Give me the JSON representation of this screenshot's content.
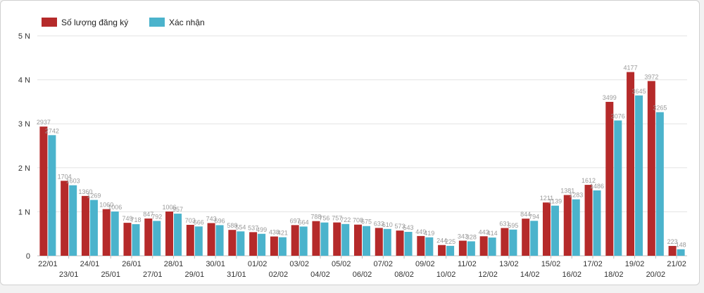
{
  "chart_data": {
    "type": "bar",
    "categories": [
      "22/01",
      "23/01",
      "24/01",
      "25/01",
      "26/01",
      "27/01",
      "28/01",
      "29/01",
      "30/01",
      "31/01",
      "01/02",
      "02/02",
      "03/02",
      "04/02",
      "05/02",
      "06/02",
      "07/02",
      "08/02",
      "09/02",
      "10/02",
      "11/02",
      "12/02",
      "13/02",
      "14/02",
      "15/02",
      "16/02",
      "17/02",
      "18/02",
      "19/02",
      "20/02",
      "21/02"
    ],
    "series": [
      {
        "name": "Số lượng đăng ký",
        "color": "#b52a2a",
        "values": [
          2937,
          1704,
          1360,
          1060,
          749,
          847,
          1006,
          703,
          743,
          588,
          537,
          438,
          697,
          788,
          757,
          708,
          633,
          573,
          449,
          244,
          343,
          443,
          631,
          844,
          1211,
          1381,
          1612,
          3499,
          4177,
          3972,
          223
        ]
      },
      {
        "name": "Xác nhận",
        "color": "#4bb3cc",
        "values": [
          2742,
          1603,
          1269,
          1006,
          718,
          792,
          957,
          666,
          696,
          554,
          499,
          421,
          664,
          756,
          722,
          675,
          610,
          543,
          419,
          225,
          328,
          414,
          595,
          794,
          1139,
          1283,
          1486,
          3076,
          3645,
          3265,
          148
        ]
      }
    ],
    "yticks": [
      0,
      1000,
      2000,
      3000,
      4000,
      5000
    ],
    "ytick_labels": [
      "0",
      "1 N",
      "2 N",
      "3 N",
      "4 N",
      "5 N"
    ],
    "ylim": [
      0,
      5000
    ],
    "grid": true,
    "legend_position": "top-left",
    "title": "",
    "xlabel": "",
    "ylabel": ""
  }
}
